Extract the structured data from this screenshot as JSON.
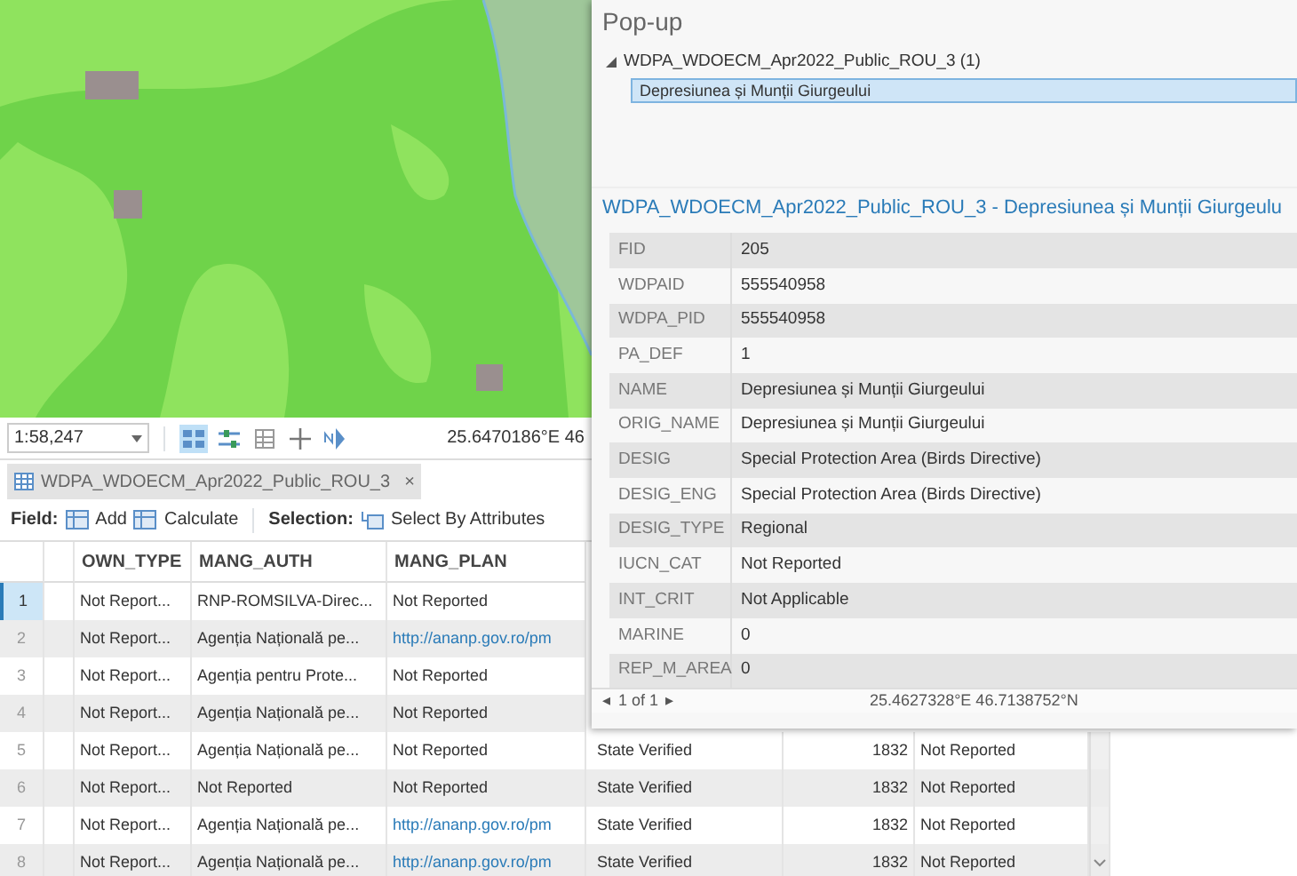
{
  "map": {
    "scale": "1:58,247",
    "coordinates": "25.6470186°E 46"
  },
  "attribute_table": {
    "tab": {
      "title": "WDPA_WDOECM_Apr2022_Public_ROU_3",
      "close": "×"
    },
    "toolbar": {
      "field_label": "Field:",
      "add": "Add",
      "calculate": "Calculate",
      "selection_label": "Selection:",
      "select_by_attributes": "Select By Attributes"
    },
    "columns": [
      "OWN_TYPE",
      "MANG_AUTH",
      "MANG_PLAN"
    ],
    "rows": [
      {
        "number": "1",
        "selected": true,
        "cells": [
          {
            "kind": "text",
            "text": "Not Report..."
          },
          {
            "kind": "text",
            "text": "RNP-ROMSILVA-Direc..."
          },
          {
            "kind": "text",
            "text": "Not Reported"
          }
        ]
      },
      {
        "number": "2",
        "selected": false,
        "cells": [
          {
            "kind": "text",
            "text": "Not Report..."
          },
          {
            "kind": "text",
            "text": "Agenția Națională pe..."
          },
          {
            "kind": "link",
            "text": "http://ananp.gov.ro/pm"
          }
        ]
      },
      {
        "number": "3",
        "selected": false,
        "cells": [
          {
            "kind": "text",
            "text": "Not Report..."
          },
          {
            "kind": "text",
            "text": "Agenția pentru Prote..."
          },
          {
            "kind": "text",
            "text": "Not Reported"
          }
        ]
      },
      {
        "number": "4",
        "selected": false,
        "cells": [
          {
            "kind": "text",
            "text": "Not Report..."
          },
          {
            "kind": "text",
            "text": "Agenția Națională pe..."
          },
          {
            "kind": "text",
            "text": "Not Reported"
          }
        ]
      },
      {
        "number": "5",
        "selected": false,
        "cells": [
          {
            "kind": "text",
            "text": "Not Report..."
          },
          {
            "kind": "text",
            "text": "Agenția Națională pe..."
          },
          {
            "kind": "text",
            "text": "Not Reported"
          },
          {
            "kind": "text",
            "text": "State Verified"
          },
          {
            "kind": "number",
            "text": "1832"
          },
          {
            "kind": "text",
            "text": "Not Reported"
          }
        ]
      },
      {
        "number": "6",
        "selected": false,
        "cells": [
          {
            "kind": "text",
            "text": "Not Report..."
          },
          {
            "kind": "text",
            "text": "Not Reported"
          },
          {
            "kind": "text",
            "text": "Not Reported"
          },
          {
            "kind": "text",
            "text": "State Verified"
          },
          {
            "kind": "number",
            "text": "1832"
          },
          {
            "kind": "text",
            "text": "Not Reported"
          }
        ]
      },
      {
        "number": "7",
        "selected": false,
        "cells": [
          {
            "kind": "text",
            "text": "Not Report..."
          },
          {
            "kind": "text",
            "text": "Agenția Națională pe..."
          },
          {
            "kind": "link",
            "text": "http://ananp.gov.ro/pm"
          },
          {
            "kind": "text",
            "text": "State Verified"
          },
          {
            "kind": "number",
            "text": "1832"
          },
          {
            "kind": "text",
            "text": "Not Reported"
          }
        ]
      },
      {
        "number": "8",
        "selected": false,
        "cells": [
          {
            "kind": "text",
            "text": "Not Report..."
          },
          {
            "kind": "text",
            "text": "Agenția Națională pe..."
          },
          {
            "kind": "link",
            "text": "http://ananp.gov.ro/pm"
          },
          {
            "kind": "text",
            "text": "State Verified"
          },
          {
            "kind": "number",
            "text": "1832"
          },
          {
            "kind": "text",
            "text": "Not Reported"
          }
        ]
      }
    ]
  },
  "popup": {
    "title": "Pop-up",
    "layer": {
      "label": "WDPA_WDOECM_Apr2022_Public_ROU_3  (1)",
      "expanded": true,
      "features": [
        {
          "label": "Depresiunea și Munții Giurgeului",
          "selected": true
        }
      ]
    },
    "heading": "WDPA_WDOECM_Apr2022_Public_ROU_3 - Depresiunea și Munții Giurgeulu",
    "fields": [
      {
        "name": "FID",
        "value": "205"
      },
      {
        "name": "WDPAID",
        "value": "555540958"
      },
      {
        "name": "WDPA_PID",
        "value": "555540958"
      },
      {
        "name": "PA_DEF",
        "value": "1"
      },
      {
        "name": "NAME",
        "value": "Depresiunea și Munții Giurgeului"
      },
      {
        "name": "ORIG_NAME",
        "value": "Depresiunea și Munții Giurgeului"
      },
      {
        "name": "DESIG",
        "value": "Special Protection Area (Birds Directive)"
      },
      {
        "name": "DESIG_ENG",
        "value": "Special Protection Area (Birds Directive)"
      },
      {
        "name": "DESIG_TYPE",
        "value": "Regional"
      },
      {
        "name": "IUCN_CAT",
        "value": "Not Reported"
      },
      {
        "name": "INT_CRIT",
        "value": "Not Applicable"
      },
      {
        "name": "MARINE",
        "value": "0"
      },
      {
        "name": "REP_M_AREA",
        "value": "0"
      }
    ],
    "pager": {
      "prev": "◂",
      "text": "1 of 1",
      "next": "▸"
    },
    "coordinates": "25.4627328°E 46.7138752°N"
  }
}
